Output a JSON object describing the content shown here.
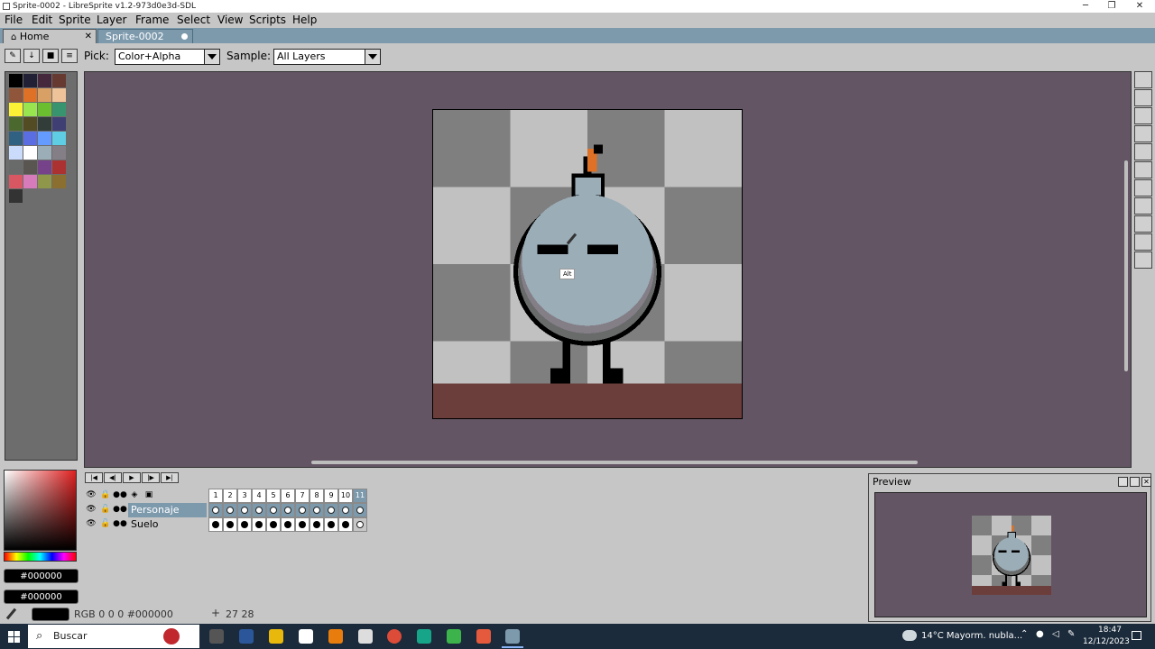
{
  "window": {
    "title": "Sprite-0002 - LibreSprite v1.2-973d0e3d-SDL",
    "controls": [
      "─",
      "❐",
      "✕"
    ]
  },
  "menu": [
    "File",
    "Edit",
    "Sprite",
    "Layer",
    "Frame",
    "Select",
    "View",
    "Scripts",
    "Help"
  ],
  "tabs": {
    "home": "Home",
    "sprite": "Sprite-0002",
    "home_close": "✕"
  },
  "tool_options": {
    "pick_label": "Pick:",
    "pick_value": "Color+Alpha",
    "sample_label": "Sample:",
    "sample_value": "All Layers"
  },
  "palette": {
    "colors": [
      "#000000",
      "#222034",
      "#45283c",
      "#663931",
      "#8f563b",
      "#df7126",
      "#d9a066",
      "#eec39a",
      "#fbf236",
      "#99e550",
      "#6abe30",
      "#37946e",
      "#4b692f",
      "#524b24",
      "#323c39",
      "#3f3f74",
      "#306082",
      "#5b6ee1",
      "#639bff",
      "#5fcde4",
      "#cbdbfc",
      "#ffffff",
      "#9badb7",
      "#847e87",
      "#696a6a",
      "#595652",
      "#76428a",
      "#ac3232",
      "#d95763",
      "#d77bba",
      "#8f974a",
      "#8a6f30",
      "#333333"
    ]
  },
  "canvas": {
    "tooltip": "Alt",
    "cursor_icon": "eyedropper-icon"
  },
  "colors": {
    "fg_hex": "#000000",
    "bg_hex": "#000000"
  },
  "timeline": {
    "frames": [
      "1",
      "2",
      "3",
      "4",
      "5",
      "6",
      "7",
      "8",
      "9",
      "10",
      "11"
    ],
    "layers": [
      {
        "name": "Personaje",
        "selected": true
      },
      {
        "name": "Suelo",
        "selected": false
      }
    ]
  },
  "preview": {
    "title": "Preview"
  },
  "status": {
    "color_info": "RGB 0 0 0 #000000",
    "position": "27 28",
    "position_icon": "+"
  },
  "taskbar": {
    "search": "Buscar",
    "weather": "14°C  Mayorm. nubla...",
    "time": "18:47",
    "date": "12/12/2023"
  }
}
